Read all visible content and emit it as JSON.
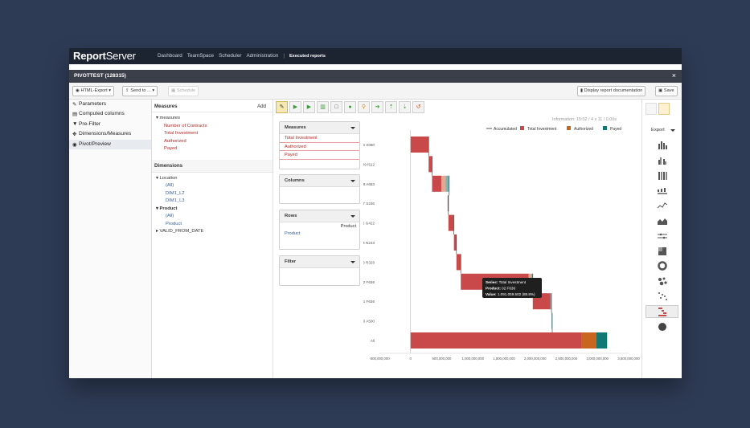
{
  "brand": {
    "name_bold": "Report",
    "name_light": "Server"
  },
  "topnav": {
    "items": [
      "Dashboard",
      "TeamSpace",
      "Scheduler",
      "Administration"
    ],
    "separator": "|",
    "current": "Executed reports"
  },
  "window": {
    "title": "PIVOTTEST (128315)",
    "close": "×"
  },
  "toolbar": {
    "export_label": "HTML-Export",
    "send_label": "Send to ...",
    "schedule_label": "Schedule",
    "doc_label": "Display report documentation",
    "save_label": "Save"
  },
  "sidebar": {
    "items": [
      {
        "label": "Parameters",
        "icon": "edit-icon"
      },
      {
        "label": "Computed columns",
        "icon": "table-icon"
      },
      {
        "label": "Pre-Filter",
        "icon": "filter-icon"
      },
      {
        "label": "Dimensions/Measures",
        "icon": "cubes-icon"
      },
      {
        "label": "Pivot/Preview",
        "icon": "eye-icon"
      }
    ],
    "selected": 4
  },
  "measures_panel": {
    "title": "Measures",
    "add": "Add",
    "root": "measures",
    "items": [
      "Number of Contracts",
      "Total Investment",
      "Authorized",
      "Payed"
    ]
  },
  "dimensions_panel": {
    "title": "Dimensions",
    "location": "Location",
    "location_children": [
      "(All)",
      "DIM1_L2",
      "DIM1_L3"
    ],
    "product": "Product",
    "product_children": [
      "(All)",
      "Product"
    ],
    "valid": "VALID_FROM_DATE"
  },
  "pivot": {
    "info": "Information:  15:02   /  4 x 11   /  0.00s",
    "measures_title": "Measures",
    "measures": [
      "Total Investment",
      "Authorized",
      "Payed"
    ],
    "columns_title": "Columns",
    "rows_title": "Rows",
    "rows_header": "Product",
    "rows_item": "Product",
    "filter_title": "Filter"
  },
  "right_panel": {
    "export_label": "Export"
  },
  "colors": {
    "total_investment": "#c9494b",
    "authorized": "#c8651f",
    "payed": "#127873",
    "accumulated": "#333333",
    "authorized_light": "#e2a98f",
    "payed_light": "#78b4b8"
  },
  "chart_data": {
    "type": "bar",
    "orientation": "horizontal",
    "categories": [
      "06 X060",
      "09 I512",
      "08 A653",
      "07 S246",
      "06 G422",
      "04 N243",
      "03 R326",
      "02 F636",
      "01 F636",
      "00 A500",
      "All"
    ],
    "legend": [
      "Accumulated",
      "Total Investment",
      "Authorized",
      "Payed"
    ],
    "legend_position": "top-right",
    "xlim": [
      -500000000,
      3500000000
    ],
    "xticks": [
      "-500,000,000",
      "0",
      "500,000,000",
      "1,000,000,000",
      "1,500,000,000",
      "2,000,000,000",
      "2,500,000,000",
      "3,000,000,000",
      "3,500,000,000"
    ],
    "bars": [
      {
        "category": "06 X060",
        "start": 0,
        "values": [
          290000000,
          0,
          0
        ]
      },
      {
        "category": "09 I512",
        "start": 290000000,
        "values": [
          55000000,
          0,
          0
        ]
      },
      {
        "category": "08 A653",
        "start": 345000000,
        "values": [
          150000000,
          70000000,
          55000000
        ]
      },
      {
        "category": "07 S246",
        "start": 595000000,
        "values": [
          8000000,
          0,
          4000000
        ]
      },
      {
        "category": "06 G422",
        "start": 607000000,
        "values": [
          80000000,
          5000000,
          4000000
        ]
      },
      {
        "category": "04 N243",
        "start": 696000000,
        "values": [
          40000000,
          0,
          0
        ]
      },
      {
        "category": "03 R326",
        "start": 736000000,
        "values": [
          70000000,
          0,
          0
        ]
      },
      {
        "category": "02 F636",
        "start": 806000000,
        "values": [
          1091059502,
          40000000,
          25000000
        ]
      },
      {
        "category": "01 F636",
        "start": 1962000000,
        "values": [
          280000000,
          0,
          20000000
        ]
      },
      {
        "category": "00 A500",
        "start": 2262000000,
        "values": [
          0,
          0,
          12000000
        ]
      },
      {
        "category": "All",
        "start": 0,
        "values": [
          2750000000,
          230000000,
          175000000
        ]
      }
    ],
    "tooltip": {
      "series_label": "Series:",
      "series": "Total Investment",
      "product_label": "Product:",
      "product": "02 F636",
      "value_label": "Value:",
      "value": "1.091.059.502 (88.8%)"
    }
  }
}
